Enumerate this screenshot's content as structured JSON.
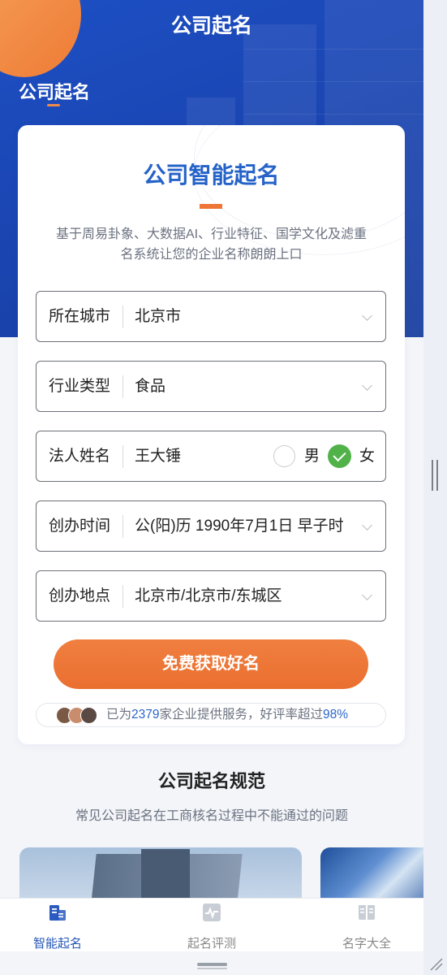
{
  "header": {
    "title": "公司起名",
    "side_tab": "公司起名"
  },
  "card": {
    "title": "公司智能起名",
    "description": "基于周易卦象、大数据AI、行业特征、国学文化及滤重名系统让您的企业名称朗朗上口"
  },
  "form": {
    "city": {
      "label": "所在城市",
      "value": "北京市"
    },
    "industry": {
      "label": "行业类型",
      "value": "食品"
    },
    "legal_person": {
      "label": "法人姓名",
      "value": "王大锤",
      "gender_options": [
        "男",
        "女"
      ],
      "selected_gender": "女"
    },
    "founding_time": {
      "label": "创办时间",
      "value": "公(阳)历 1990年7月1日 早子时"
    },
    "founding_place": {
      "label": "创办地点",
      "value": "北京市/北京市/东城区"
    },
    "submit_label": "免费获取好名"
  },
  "service": {
    "prefix": "已为",
    "count": "2379",
    "middle": "家企业提供服务，好评率超过",
    "rate": "98%"
  },
  "section": {
    "title": "公司起名规范",
    "subtitle": "常见公司起名在工商核名过程中不能通过的问题"
  },
  "tabs": [
    {
      "label": "智能起名",
      "icon": "building-icon",
      "active": true
    },
    {
      "label": "起名评测",
      "icon": "pulse-chart-icon",
      "active": false
    },
    {
      "label": "名字大全",
      "icon": "book-icon",
      "active": false
    }
  ],
  "colors": {
    "primary_blue": "#2563c8",
    "accent_orange": "#ee7535",
    "check_green": "#52b24a"
  }
}
